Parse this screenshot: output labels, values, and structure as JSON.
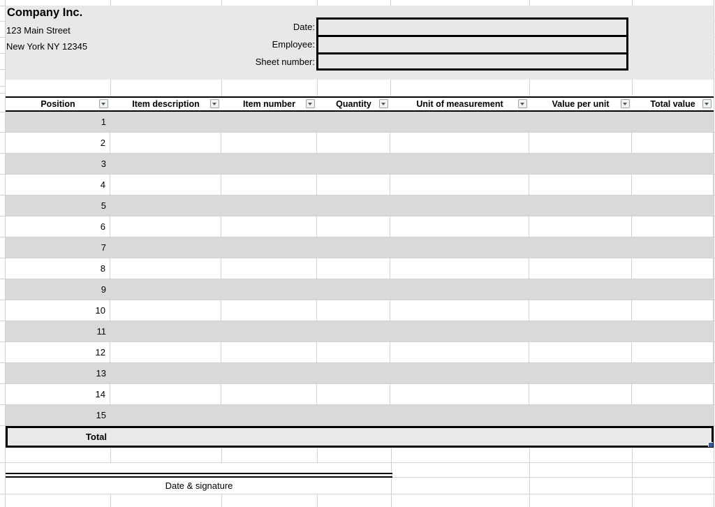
{
  "company": {
    "name": "Company Inc.",
    "address_line1": "123 Main Street",
    "address_line2": "New York NY 12345"
  },
  "form_fields": [
    {
      "id": "date",
      "label": "Date:",
      "value": ""
    },
    {
      "id": "employee",
      "label": "Employee:",
      "value": ""
    },
    {
      "id": "sheet_number",
      "label": "Sheet number:",
      "value": ""
    }
  ],
  "table": {
    "columns": [
      "Position",
      "Item description",
      "Item number",
      "Quantity",
      "Unit of measurement",
      "Value per unit",
      "Total value"
    ],
    "rows": [
      "1",
      "2",
      "3",
      "4",
      "5",
      "6",
      "7",
      "8",
      "9",
      "10",
      "11",
      "12",
      "13",
      "14",
      "15"
    ],
    "total_label": "Total",
    "filter_icon": "chevron-down-icon"
  },
  "footer": {
    "signature_label": "Date & signature"
  },
  "colors": {
    "header_block_bg": "#e8e8e8",
    "row_stripe_bg": "#d9d9d9",
    "total_row_bg": "#e9e9e9",
    "gridline": "#d2d2d2",
    "table_border": "#000000",
    "selection_handle": "#35599e",
    "filter_button_bg": "#f2f3f5",
    "filter_button_border": "#99a0a8"
  }
}
